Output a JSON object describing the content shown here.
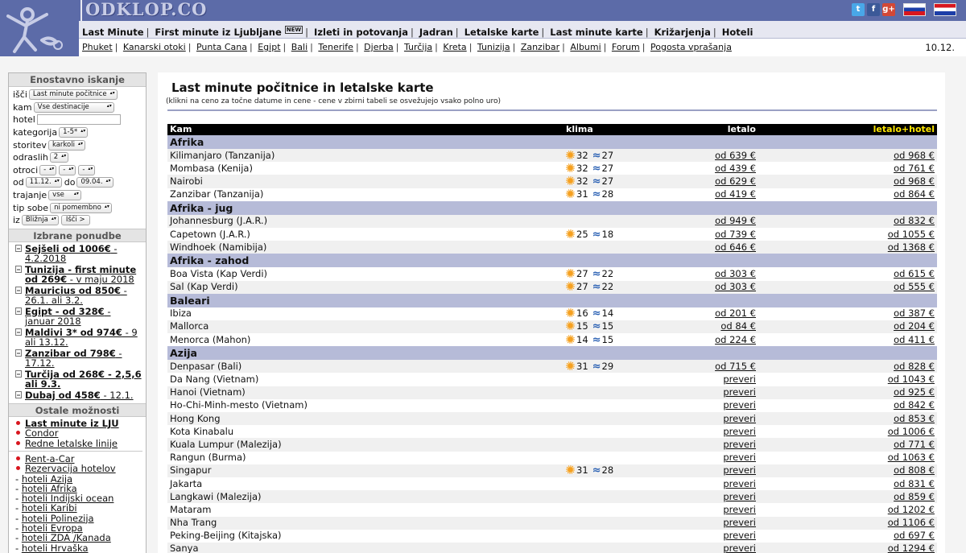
{
  "logo": {
    "text": "ODKLOP.COM"
  },
  "colors": {
    "header_band": "#5c6ba8",
    "region_row": "#b6bbd8",
    "table_header": "#000000",
    "letalo_hotel_header": "#ffe600",
    "bullet": "#d8161e"
  },
  "social": [
    {
      "name": "twitter-icon",
      "glyph": "t",
      "color": "#49a7e8"
    },
    {
      "name": "facebook-icon",
      "glyph": "f",
      "color": "#3b5998"
    },
    {
      "name": "google-plus-icon",
      "glyph": "g+",
      "color": "#d34836"
    }
  ],
  "nav": {
    "main": [
      "Last Minute",
      "First minute iz Ljubljane",
      "Izleti in potovanja",
      "Jadran",
      "Letalske karte",
      "Last minute karte",
      "Križarjenja",
      "Hoteli"
    ],
    "main_badge": "NEW",
    "sub": [
      "Phuket",
      "Kanarski otoki",
      "Punta Cana",
      "Egipt",
      "Bali",
      "Tenerife",
      "Djerba",
      "Turčija",
      "Kreta",
      "Tunizija",
      "Zanzibar",
      "Albumi",
      "Forum",
      "Pogosta vprašanja"
    ],
    "date": "10.12."
  },
  "sidebar": {
    "search": {
      "title": "Enostavno iskanje",
      "isci_label": "išči",
      "isci_value": "Last minute počitnice",
      "kam_label": "kam",
      "kam_value": "Vse destinacije",
      "hotel_label": "hotel",
      "kategorija_label": "kategorija",
      "kategorija_value": "1-5*",
      "storitev_label": "storitev",
      "storitev_value": "karkoli",
      "odraslih_label": "odraslih",
      "odraslih_value": "2",
      "otroci_label": "otroci",
      "otroci_values": [
        "-",
        "-",
        "-"
      ],
      "od_label": "od",
      "od_value": "11.12.",
      "do_label": "do",
      "do_value": "09.04.",
      "trajanje_label": "trajanje",
      "trajanje_value": "vse",
      "tipsobe_label": "tip sobe",
      "tipsobe_value": "ni pomembno",
      "iz_label": "iz",
      "iz_value": "Bližnja",
      "button": "Išči >"
    },
    "offers_title": "Izbrane ponudbe",
    "offers": [
      {
        "bold": "Sejšeli od 1006€",
        "rest": " - 4.2.2018"
      },
      {
        "bold": "Tunizija - first minute od 269€",
        "rest": " - v maju 2018"
      },
      {
        "bold": "Mauricius od 850€",
        "rest": " - 26.1. ali 3.2."
      },
      {
        "bold": "Egipt - od 328€",
        "rest": " - januar 2018"
      },
      {
        "bold": "Maldivi 3* od 974€",
        "rest": " - 9 ali 13.12."
      },
      {
        "bold": "Zanzibar od 798€",
        "rest": " - 17.12."
      },
      {
        "bold": "Turčija od 268€ - 2,5,6 ali 9.3.",
        "rest": ""
      },
      {
        "bold": "Dubaj od 458€",
        "rest": " - 12.1."
      }
    ],
    "other_title": "Ostale možnosti",
    "other_bullets_1": [
      {
        "label": "Last minute iz LJU",
        "bold": true
      },
      {
        "label": "Condor",
        "bold": false
      },
      {
        "label": "Redne letalske linije",
        "bold": false
      }
    ],
    "other_bullets_2": [
      "Rent-a-Car",
      "Rezervacija hotelov"
    ],
    "hotel_links": [
      "hoteli Azija",
      "hoteli Afrika",
      "hoteli Indijski ocean",
      "hoteli Karibi",
      "hoteli Polinezija",
      "hoteli Evropa",
      "hoteli ZDA /Kanada",
      "hoteli Hrvaška"
    ]
  },
  "main": {
    "title": "Last minute počitnice in letalske karte",
    "subtitle": "(klikni na ceno za točne datume in cene - cene v zbirni tabeli se osvežujejo vsako polno uro)",
    "columns": [
      "Kam",
      "klima",
      "letalo",
      "letalo+hotel"
    ],
    "regions": [
      {
        "name": "Afrika",
        "rows": [
          {
            "dest": "Kilimanjaro (Tanzanija)",
            "air_t": "32",
            "sea_t": "27",
            "air": "od 639 €",
            "hotel": "od 968 €"
          },
          {
            "dest": "Mombasa (Kenija)",
            "air_t": "32",
            "sea_t": "27",
            "air": "od 439 €",
            "hotel": "od 761 €"
          },
          {
            "dest": "Nairobi",
            "air_t": "32",
            "sea_t": "27",
            "air": "od 629 €",
            "hotel": "od 968 €"
          },
          {
            "dest": "Zanzibar (Tanzanija)",
            "air_t": "31",
            "sea_t": "28",
            "air": "od 419 €",
            "hotel": "od 864 €"
          }
        ]
      },
      {
        "name": "Afrika - jug",
        "rows": [
          {
            "dest": "Johannesburg (J.A.R.)",
            "air_t": "",
            "sea_t": "",
            "air": "od 949 €",
            "hotel": "od 832 €"
          },
          {
            "dest": "Capetown (J.A.R.)",
            "air_t": "25",
            "sea_t": "18",
            "air": "od 739 €",
            "hotel": "od 1055 €"
          },
          {
            "dest": "Windhoek (Namibija)",
            "air_t": "",
            "sea_t": "",
            "air": "od 646 €",
            "hotel": "od 1368 €"
          }
        ]
      },
      {
        "name": "Afrika - zahod",
        "rows": [
          {
            "dest": "Boa Vista (Kap Verdi)",
            "air_t": "27",
            "sea_t": "22",
            "air": "od 303 €",
            "hotel": "od 615 €"
          },
          {
            "dest": "Sal (Kap Verdi)",
            "air_t": "27",
            "sea_t": "22",
            "air": "od 303 €",
            "hotel": "od 555 €"
          }
        ]
      },
      {
        "name": "Baleari",
        "rows": [
          {
            "dest": "Ibiza",
            "air_t": "16",
            "sea_t": "14",
            "air": "od 201 €",
            "hotel": "od 387 €"
          },
          {
            "dest": "Mallorca",
            "air_t": "15",
            "sea_t": "15",
            "air": "od 84 €",
            "hotel": "od 204 €"
          },
          {
            "dest": "Menorca (Mahon)",
            "air_t": "14",
            "sea_t": "15",
            "air": "od 224 €",
            "hotel": "od 411 €"
          }
        ]
      },
      {
        "name": "Azija",
        "rows": [
          {
            "dest": "Denpasar (Bali)",
            "air_t": "31",
            "sea_t": "29",
            "air": "od 715 €",
            "hotel": "od 828 €"
          },
          {
            "dest": "Da Nang (Vietnam)",
            "air_t": "",
            "sea_t": "",
            "air": "preveri",
            "hotel": "od 1043 €"
          },
          {
            "dest": "Hanoi (Vietnam)",
            "air_t": "",
            "sea_t": "",
            "air": "preveri",
            "hotel": "od 925 €"
          },
          {
            "dest": "Ho-Chi-Minh-mesto (Vietnam)",
            "air_t": "",
            "sea_t": "",
            "air": "preveri",
            "hotel": "od 842 €"
          },
          {
            "dest": "Hong Kong",
            "air_t": "",
            "sea_t": "",
            "air": "preveri",
            "hotel": "od 853 €"
          },
          {
            "dest": "Kota Kinabalu",
            "air_t": "",
            "sea_t": "",
            "air": "preveri",
            "hotel": "od 1006 €"
          },
          {
            "dest": "Kuala Lumpur (Malezija)",
            "air_t": "",
            "sea_t": "",
            "air": "preveri",
            "hotel": "od 771 €"
          },
          {
            "dest": "Rangun (Burma)",
            "air_t": "",
            "sea_t": "",
            "air": "preveri",
            "hotel": "od 1063 €"
          },
          {
            "dest": "Singapur",
            "air_t": "31",
            "sea_t": "28",
            "air": "preveri",
            "hotel": "od 808 €"
          },
          {
            "dest": "Jakarta",
            "air_t": "",
            "sea_t": "",
            "air": "preveri",
            "hotel": "od 831 €"
          },
          {
            "dest": "Langkawi (Malezija)",
            "air_t": "",
            "sea_t": "",
            "air": "preveri",
            "hotel": "od 859 €"
          },
          {
            "dest": "Mataram",
            "air_t": "",
            "sea_t": "",
            "air": "preveri",
            "hotel": "od 1202 €"
          },
          {
            "dest": "Nha Trang",
            "air_t": "",
            "sea_t": "",
            "air": "preveri",
            "hotel": "od 1106 €"
          },
          {
            "dest": "Peking-Beijing (Kitajska)",
            "air_t": "",
            "sea_t": "",
            "air": "preveri",
            "hotel": "od 697 €"
          },
          {
            "dest": "Sanya",
            "air_t": "",
            "sea_t": "",
            "air": "preveri",
            "hotel": "od 1294 €"
          }
        ]
      }
    ]
  }
}
